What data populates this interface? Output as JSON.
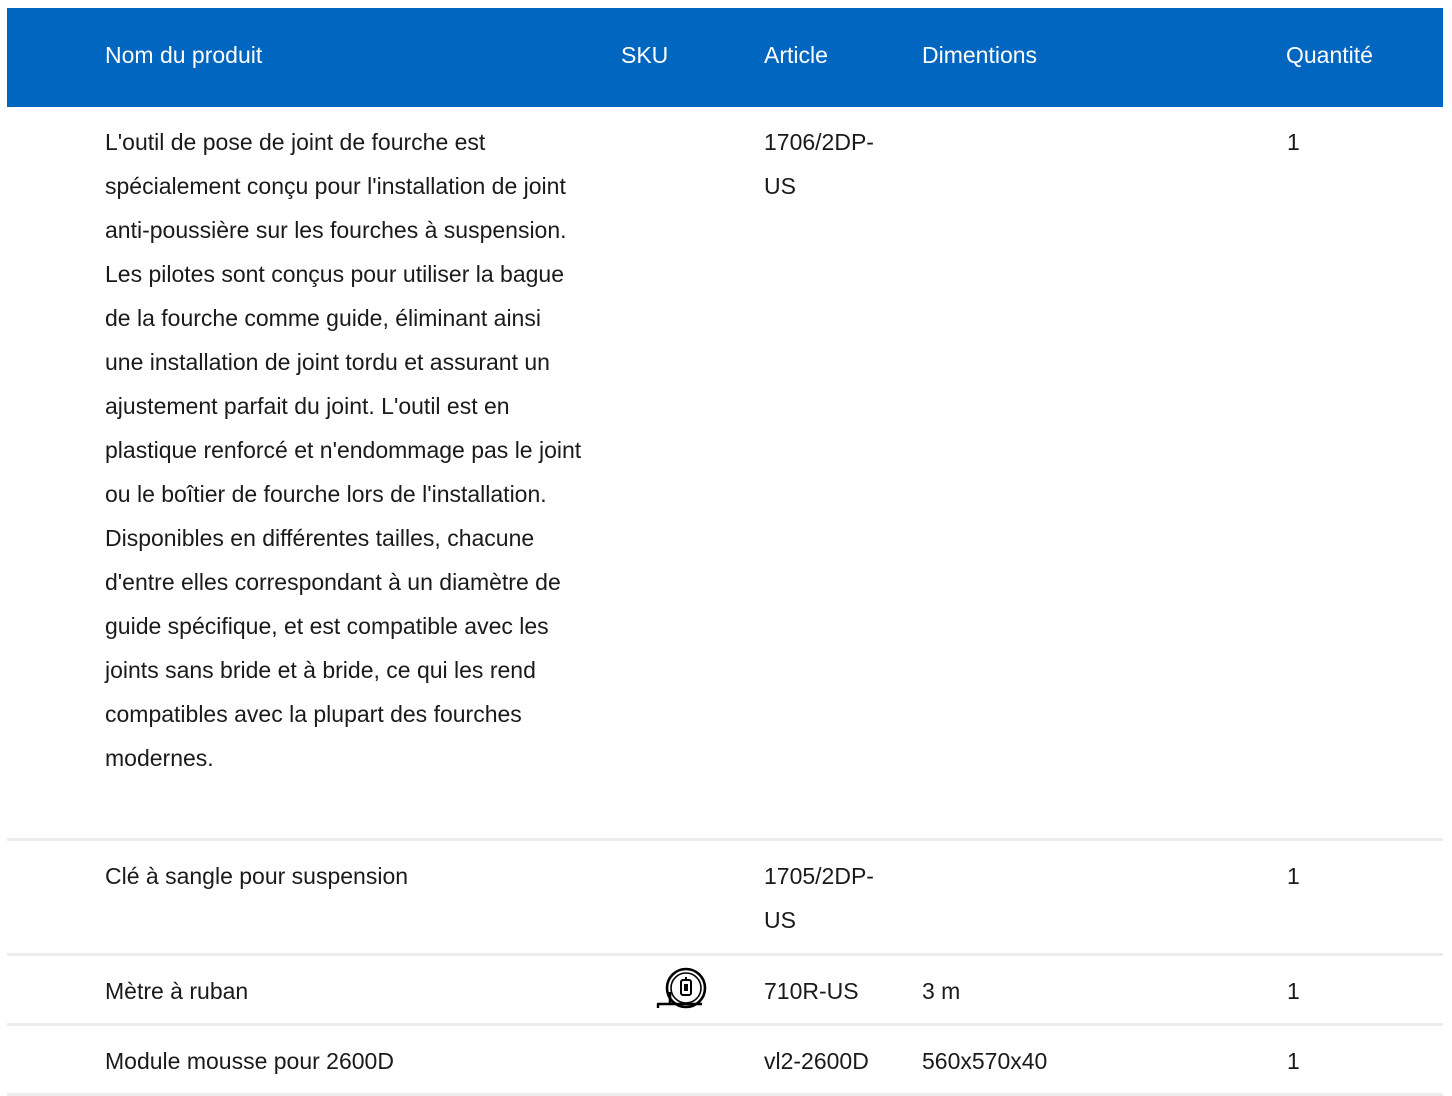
{
  "table": {
    "headers": {
      "name": "Nom du produit",
      "sku": "SKU",
      "article": "Article",
      "dimensions": "Dimentions",
      "quantity": "Quantité"
    },
    "rows": [
      {
        "name": "L'outil de pose de joint de fourche est spécialement conçu pour l'installation de joint anti-poussière sur les fourches à suspension. Les pilotes sont conçus pour utiliser la bague de la fourche comme guide, éliminant ainsi une installation de joint tordu et assurant un ajustement parfait du joint. L'outil est en plastique renforcé et n'endommage pas le joint ou le boîtier de fourche lors de l'installation. Disponibles en différentes tailles, chacune d'entre elles correspondant à un diamètre de guide spécifique, et est compatible avec les joints sans bride et à bride, ce qui les rend compatibles avec la plupart des fourches modernes.",
        "sku_icon": "",
        "article": "1706/2DP-US",
        "dimensions": "",
        "quantity": "1"
      },
      {
        "name": "Clé à sangle pour suspension",
        "sku_icon": "",
        "article": "1705/2DP-US",
        "dimensions": "",
        "quantity": "1"
      },
      {
        "name": "Mètre à ruban",
        "sku_icon": "tape-measure-icon",
        "article": "710R-US",
        "dimensions": "3 m",
        "quantity": "1"
      },
      {
        "name": "Module mousse pour 2600D",
        "sku_icon": "",
        "article": "vl2-2600D",
        "dimensions": "560x570x40",
        "quantity": "1"
      }
    ]
  },
  "colors": {
    "header_bg": "#0066c0",
    "header_text": "#ffffff",
    "row_divider": "#ececec",
    "body_text": "#1a1a1a"
  }
}
